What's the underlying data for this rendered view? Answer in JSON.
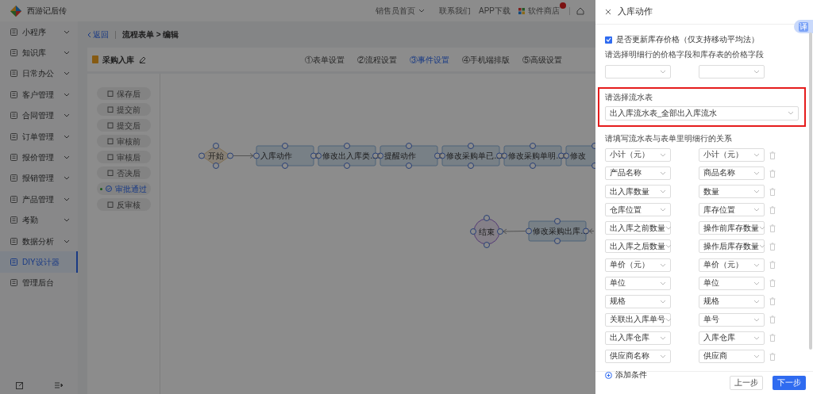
{
  "header": {
    "app_name": "西游记后传",
    "links": [
      {
        "label": "销售员首页",
        "kind": "dropdown"
      },
      {
        "label": "联系我们",
        "kind": "link"
      },
      {
        "label": "APP下载",
        "kind": "link"
      },
      {
        "label": "软件商店",
        "kind": "store"
      },
      {
        "kind": "home"
      }
    ]
  },
  "sidebar": {
    "items": [
      {
        "label": "小程序",
        "expandable": true,
        "selected": false
      },
      {
        "label": "知识库",
        "expandable": true,
        "selected": false
      },
      {
        "label": "日常办公",
        "expandable": true,
        "selected": false
      },
      {
        "label": "客户管理",
        "expandable": true,
        "selected": false
      },
      {
        "label": "合同管理",
        "expandable": true,
        "selected": false
      },
      {
        "label": "订单管理",
        "expandable": true,
        "selected": false
      },
      {
        "label": "报价管理",
        "expandable": true,
        "selected": false
      },
      {
        "label": "报销管理",
        "expandable": true,
        "selected": false
      },
      {
        "label": "产品管理",
        "expandable": true,
        "selected": false
      },
      {
        "label": "考勤",
        "expandable": true,
        "selected": false
      },
      {
        "label": "数据分析",
        "expandable": true,
        "selected": false
      },
      {
        "label": "DIY设计器",
        "expandable": false,
        "selected": true
      },
      {
        "label": "管理后台",
        "expandable": false,
        "selected": false
      }
    ]
  },
  "breadcrumb": {
    "back": "返回",
    "path": "流程表单 > 编辑"
  },
  "form": {
    "title": "采购入库",
    "tabs": [
      {
        "label": "①表单设置",
        "selected": false
      },
      {
        "label": "②流程设置",
        "selected": false
      },
      {
        "label": "③事件设置",
        "selected": true
      },
      {
        "label": "④手机端排版",
        "selected": false
      },
      {
        "label": "⑤高级设置",
        "selected": false
      }
    ]
  },
  "events": [
    {
      "label": "保存后",
      "selected": false
    },
    {
      "label": "提交前",
      "selected": false
    },
    {
      "label": "提交后",
      "selected": false
    },
    {
      "label": "审核前",
      "selected": false
    },
    {
      "label": "审核后",
      "selected": false
    },
    {
      "label": "否决后",
      "selected": false
    },
    {
      "label": "审批通过",
      "selected": true
    },
    {
      "label": "反审核",
      "selected": false
    }
  ],
  "flow": {
    "nodes": [
      {
        "label": "开始",
        "kind": "start"
      },
      {
        "label": "入库动作",
        "kind": "action"
      },
      {
        "label": "修改出入库类…",
        "kind": "action"
      },
      {
        "label": "提醒动作",
        "kind": "action"
      },
      {
        "label": "修改采购单已…",
        "kind": "action"
      },
      {
        "label": "修改采购单明…",
        "kind": "action"
      },
      {
        "label": "修改",
        "kind": "action"
      },
      {
        "label": "结束",
        "kind": "end"
      },
      {
        "label": "修改采购出库…",
        "kind": "action"
      }
    ]
  },
  "drawer": {
    "title": "入库动作",
    "translate_button": "译",
    "update_price": {
      "label": "是否更新库存价格（仅支持移动平均法）",
      "checked": true
    },
    "price_fields_label": "请选择明细行的价格字段和库存表的价格字段",
    "flow_table": {
      "label": "请选择流水表",
      "value": "出入库流水表_全部出入库流水"
    },
    "relation_label": "请填写流水表与表单里明细行的关系",
    "mappings": [
      {
        "left": "小计（元）",
        "right": "小计（元）"
      },
      {
        "left": "产品名称",
        "right": "商品名称"
      },
      {
        "left": "出入库数量",
        "right": "数量"
      },
      {
        "left": "仓库位置",
        "right": "库存位置"
      },
      {
        "left": "出入库之前数量",
        "right": "操作前库存数量"
      },
      {
        "left": "出入库之后数量",
        "right": "操作后库存数量"
      },
      {
        "left": "单价（元）",
        "right": "单价（元）"
      },
      {
        "left": "单位",
        "right": "单位"
      },
      {
        "left": "规格",
        "right": "规格"
      },
      {
        "left": "关联出入库单号",
        "right": "单号"
      },
      {
        "left": "出入库仓库",
        "right": "入库仓库"
      },
      {
        "left": "供应商名称",
        "right": "供应商"
      }
    ],
    "add_condition": "添加条件",
    "buttons": [
      {
        "label": "上一步",
        "kind": "secondary"
      },
      {
        "label": "下一步",
        "kind": "primary"
      }
    ]
  }
}
